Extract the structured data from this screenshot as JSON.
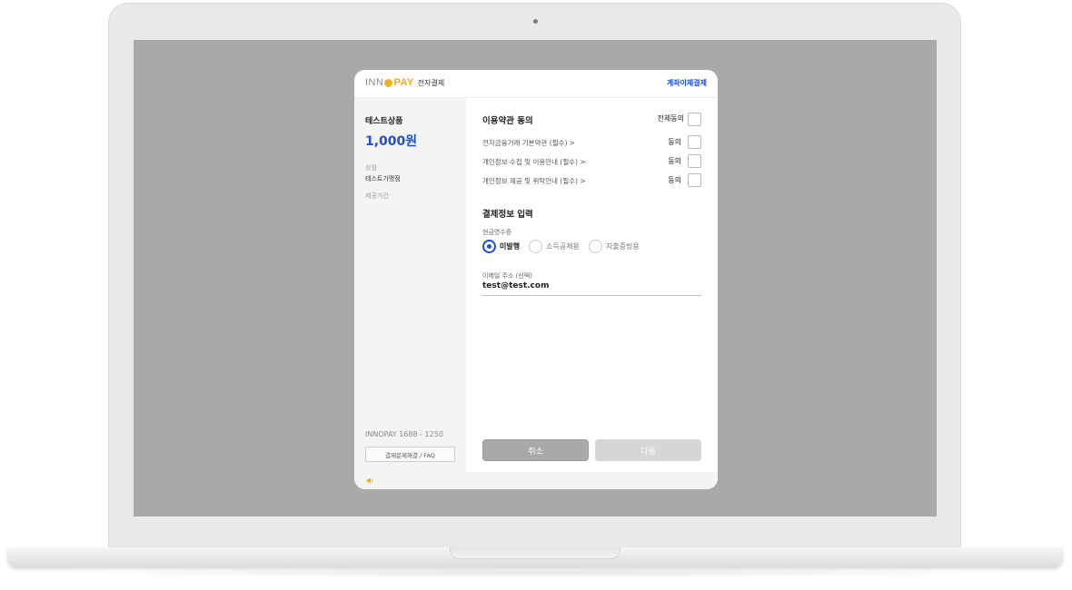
{
  "header": {
    "logo_inno": "INN",
    "logo_pay": "PAY",
    "logo_sub": "전자결제",
    "payment_method": "계좌이체결제"
  },
  "product": {
    "name": "테스트상품",
    "price": "1,000원",
    "store_label": "상점",
    "store_value": "테스트가맹점",
    "period_label": "제공기간"
  },
  "support": {
    "phone": "INNOPAY 1688 - 1250",
    "faq_button": "결제문제해결 / FAQ"
  },
  "terms": {
    "title": "이용약관 동의",
    "agree_all": "전체동의",
    "items": [
      {
        "label": "전자금융거래 기본약관 (필수)  >",
        "agree": "동의"
      },
      {
        "label": "개인정보 수집 및 이용안내 (필수)  >",
        "agree": "동의"
      },
      {
        "label": "개인정보 제공 및 위탁안내 (필수)  >",
        "agree": "동의"
      }
    ]
  },
  "payment_info": {
    "title": "결제정보 입력",
    "receipt_label": "현금영수증",
    "receipt_options": [
      "미발행",
      "소득공제용",
      "지출증빙용"
    ],
    "selected_option": "미발행",
    "email_label": "이메일 주소 (선택)",
    "email_value": "test@test.com"
  },
  "buttons": {
    "cancel": "취소",
    "next": "다음"
  },
  "colors": {
    "accent": "#1d4fd3",
    "brand_yellow": "#f3a60d",
    "screen_bg": "#a9a9a9"
  },
  "icons": [
    "speaker-icon",
    "chevron-right-icon"
  ]
}
